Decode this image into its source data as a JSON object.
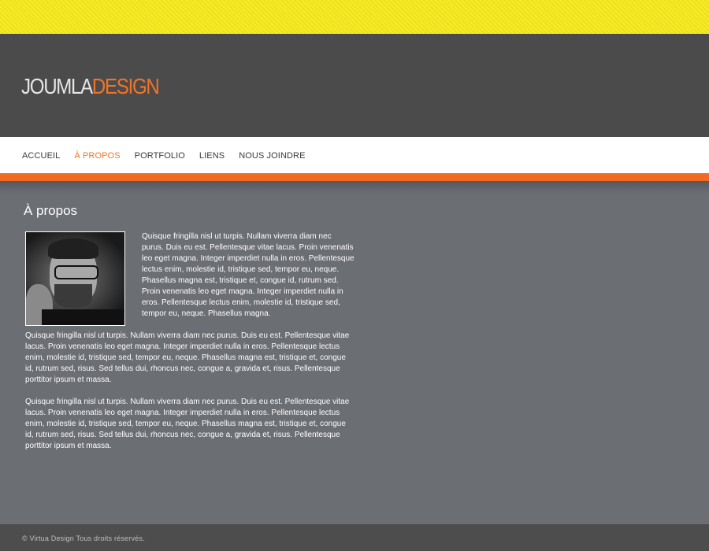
{
  "header": {
    "logo_part1": "JOUMLA",
    "logo_part2": "DESIGN"
  },
  "nav": {
    "items": [
      {
        "label": "ACCUEIL",
        "active": false
      },
      {
        "label": "À PROPOS",
        "active": true
      },
      {
        "label": "PORTFOLIO",
        "active": false
      },
      {
        "label": "LIENS",
        "active": false
      },
      {
        "label": "NOUS JOINDRE",
        "active": false
      }
    ]
  },
  "main": {
    "title": "À propos",
    "intro": "Quisque fringilla nisl ut turpis. Nullam viverra diam nec purus. Duis eu est. Pellentesque vitae lacus. Proin venenatis leo eget magna. Integer imperdiet nulla in eros. Pellentesque lectus enim, molestie id, tristique sed, tempor eu, neque. Phasellus magna est, tristique et, congue id, rutrum sed. Proin venenatis leo eget magna. Integer imperdiet nulla in eros. Pellentesque lectus enim, molestie id, tristique sed, tempor eu, neque. Phasellus magna.",
    "paragraphs": [
      "Quisque fringilla nisl ut turpis. Nullam viverra diam nec purus. Duis eu est. Pellentesque vitae lacus. Proin venenatis leo eget magna. Integer imperdiet nulla in eros. Pellentesque lectus enim, molestie id, tristique sed, tempor eu, neque. Phasellus magna est, tristique et, congue id, rutrum sed, risus. Sed tellus dui, rhoncus nec, congue a, gravida et, risus. Pellentesque porttitor ipsum et massa.",
      "Quisque fringilla nisl ut turpis. Nullam viverra diam nec purus. Duis eu est. Pellentesque vitae lacus. Proin venenatis leo eget magna. Integer imperdiet nulla in eros. Pellentesque lectus enim, molestie id, tristique sed, tempor eu, neque. Phasellus magna est, tristique et, congue id, rutrum sed, risus. Sed tellus dui, rhoncus nec, congue a, gravida et, risus. Pellentesque porttitor ipsum et massa."
    ]
  },
  "footer": {
    "text": "© Virtua Design Tous droits réservés."
  },
  "colors": {
    "accent": "#f07428",
    "top_stripe": "#f5e81a",
    "header_bg": "#4b4b4b",
    "content_bg": "#6b6e73"
  }
}
